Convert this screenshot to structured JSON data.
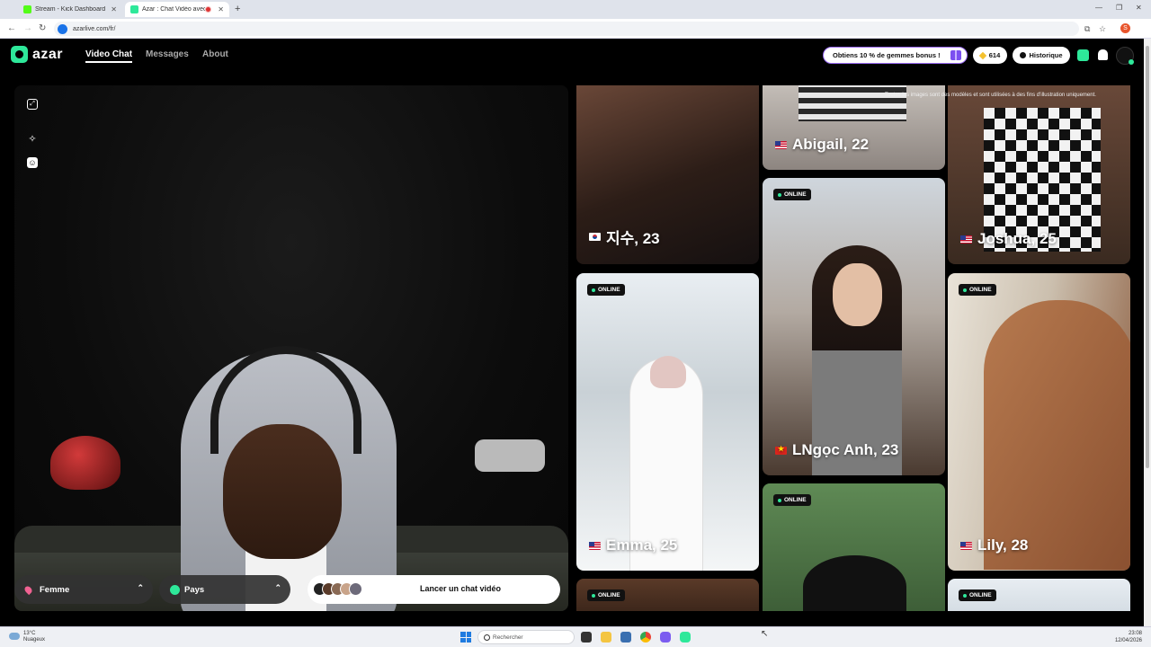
{
  "browser": {
    "tabs": [
      {
        "label": "Stream - Kick Dashboard",
        "favicon_color": "#53fc18"
      },
      {
        "label": "Azar : Chat Vidéo avec de",
        "favicon_color": "#2ee89a"
      }
    ],
    "url": "azarlive.com/fr/",
    "profile_initial": "S"
  },
  "header": {
    "logo": "azar",
    "nav": [
      {
        "label": "Video Chat",
        "active": true
      },
      {
        "label": "Messages",
        "active": false
      },
      {
        "label": "About",
        "active": false
      }
    ],
    "promo_label": "Obtiens 10 % de gemmes bonus !",
    "gems_count": "614",
    "history_label": "Historique"
  },
  "video_panel": {
    "gender_filter": "Femme",
    "country_filter": "Pays",
    "start_label": "Lancer un chat vidéo"
  },
  "gallery": {
    "disclaimer": "Toutes les images sont des modèles et sont utilisées à des fins d'illustration uniquement.",
    "online_label": "ONLINE",
    "profiles": [
      {
        "name": "지수, 23",
        "flag": "kr",
        "online": false
      },
      {
        "name": "Abigail, 22",
        "flag": "us",
        "online": false
      },
      {
        "name": "Joshua, 25",
        "flag": "us",
        "online": false
      },
      {
        "name": "LNgọc Anh, 23",
        "flag": "vn",
        "online": true
      },
      {
        "name": "Emma, 25",
        "flag": "us",
        "online": true
      },
      {
        "name": "Lily, 28",
        "flag": "us",
        "online": true
      }
    ]
  },
  "taskbar": {
    "temperature": "13°C",
    "weather": "Nuageux",
    "search_placeholder": "Rechercher",
    "time": "23:08",
    "date": "12/04/2026"
  }
}
